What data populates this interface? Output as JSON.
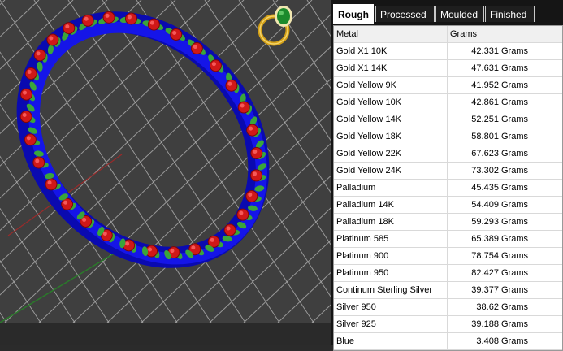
{
  "tabs": [
    "Rough",
    "Processed",
    "Moulded",
    "Finished"
  ],
  "active_tab": "Rough",
  "table": {
    "headers": [
      "Metal",
      "Grams"
    ],
    "rows": [
      {
        "metal": "Gold X1 10K",
        "grams": "42.331 Grams"
      },
      {
        "metal": "Gold X1 14K",
        "grams": "47.631 Grams"
      },
      {
        "metal": "Gold Yellow 9K",
        "grams": "41.952 Grams"
      },
      {
        "metal": "Gold Yellow 10K",
        "grams": "42.861 Grams"
      },
      {
        "metal": "Gold Yellow 14K",
        "grams": "52.251 Grams"
      },
      {
        "metal": "Gold Yellow 18K",
        "grams": "58.801 Grams"
      },
      {
        "metal": "Gold Yellow 22K",
        "grams": "67.623 Grams"
      },
      {
        "metal": "Gold Yellow 24K",
        "grams": "73.302 Grams"
      },
      {
        "metal": "Palladium",
        "grams": "45.435 Grams"
      },
      {
        "metal": "Palladium 14K",
        "grams": "54.409 Grams"
      },
      {
        "metal": "Palladium 18K",
        "grams": "59.293 Grams"
      },
      {
        "metal": "Platinum 585",
        "grams": "65.389 Grams"
      },
      {
        "metal": "Platinum 900",
        "grams": "78.754 Grams"
      },
      {
        "metal": "Platinum 950",
        "grams": "82.427 Grams"
      },
      {
        "metal": "Continum Sterling Silver",
        "grams": "39.377 Grams"
      },
      {
        "metal": "Silver 950",
        "grams": "38.62 Grams"
      },
      {
        "metal": "Silver 925",
        "grams": "39.188 Grams"
      },
      {
        "metal": "Blue",
        "grams": "3.408 Grams"
      }
    ]
  },
  "colors": {
    "viewport_bg": "#3f3f3f",
    "bangle": "#1010e0",
    "rose": "#d01818",
    "leaf": "#3aa53a",
    "gem": "#1c8a2c",
    "ring": "#d4a017"
  }
}
